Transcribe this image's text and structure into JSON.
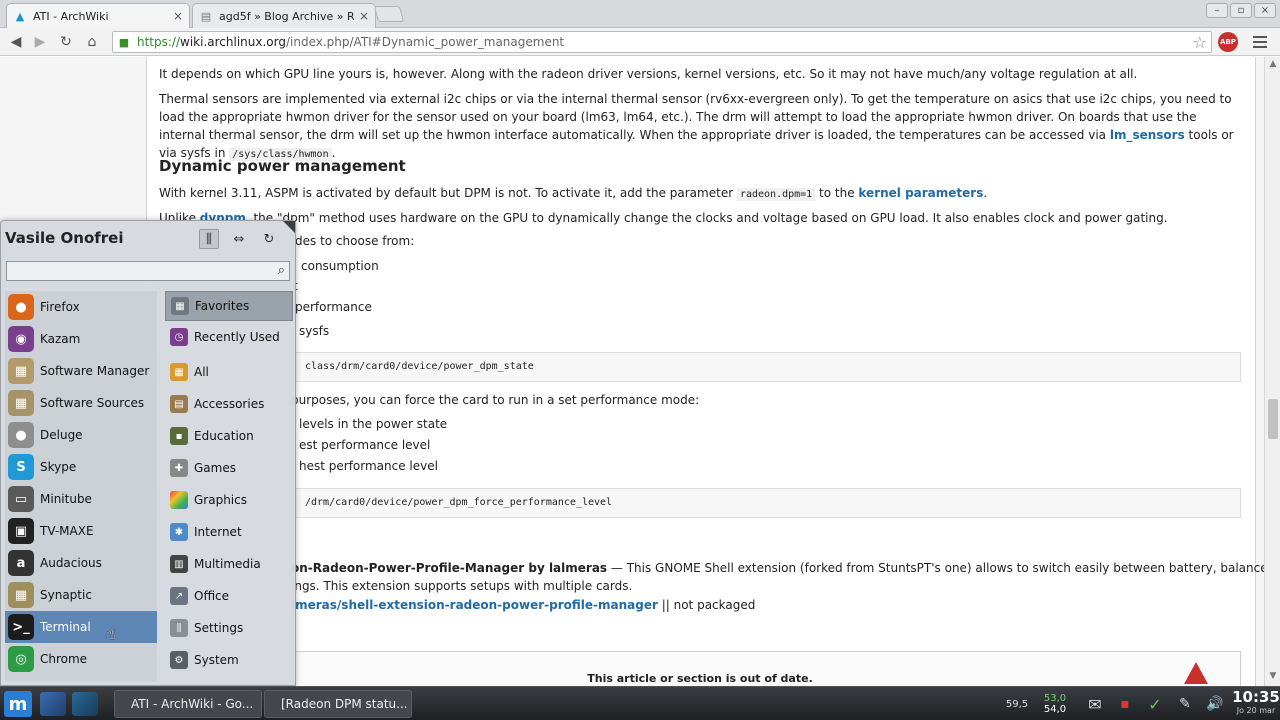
{
  "browser": {
    "tabs": [
      {
        "title": "ATI - ArchWiki",
        "close": "×"
      },
      {
        "title": "agd5f » Blog Archive » Ra",
        "close": "×"
      }
    ],
    "window_controls": {
      "minimize": "–",
      "maximize": "▫",
      "close": "×"
    },
    "url": {
      "scheme": "https://",
      "host": "wiki.archlinux.org",
      "path": "/index.php/ATI#Dynamic_power_management"
    },
    "abp_label": "ABP"
  },
  "article": {
    "p1": "It depends on which GPU line yours is, however. Along with the radeon driver versions, kernel versions, etc. So it may not have much/any voltage regulation at all.",
    "p2_a": "Thermal sensors are implemented via external i2c chips or via the internal thermal sensor (rv6xx-evergreen only). To get the temperature on asics that use i2c chips, you need to load the appropriate hwmon driver for the sensor used on your board (lm63, lm64, etc.). The drm will attempt to load the appropriate hwmon driver. On boards that use the internal thermal sensor, the drm will set up the hwmon interface automatically. When the appropriate driver is loaded, the temperatures can be accessed via ",
    "p2_link": "lm_sensors",
    "p2_b": " tools or via sysfs in ",
    "p2_code": "/sys/class/hwmon",
    "p2_c": ".",
    "heading": "Dynamic power management",
    "p3_a": "With kernel 3.11, ASPM is activated by default but DPM is not. To activate it, add the parameter ",
    "p3_code": "radeon.dpm=1",
    "p3_b": " to the ",
    "p3_link": "kernel parameters",
    "p3_c": ".",
    "p4_a": "Unlike ",
    "p4_link": "dynpm",
    "p4_b": ", the \"dpm\" method uses hardware on the GPU to dynamically change the clocks and voltage based on GPU load. It also enables clock and power gating.",
    "p5": "des to choose from:",
    "l1": "consumption",
    "l2": "t",
    "l3": "performance",
    "l4": "sysfs",
    "pre1": "class/drm/card0/device/power_dpm_state",
    "p6": "purposes, you can force the card to run in a set performance mode:",
    "l5": "levels in the power state",
    "l6": "est performance level",
    "l7": "hest performance level",
    "pre2": "/drm/card0/device/power_dpm_force_performance_level",
    "ext_title": "on-Radeon-Power-Profile-Manager by lalmeras",
    "ext_desc_a": " — This GNOME Shell extension (forked from StuntsPT's one) allows to switch easily between battery, balanced and",
    "ext_desc_b": "ings. This extension supports setups with multiple cards.",
    "ext_link": "lmeras/shell-extension-radeon-power-profile-manager",
    "ext_suffix": " || not packaged",
    "notice": "This article or section is out of date."
  },
  "startmenu": {
    "user": "Vasile Onofrei",
    "apps": [
      {
        "label": "Firefox",
        "color": "#d9661b"
      },
      {
        "label": "Kazam",
        "color": "#7a3f8c"
      },
      {
        "label": "Software Manager",
        "color": "#b49a6a"
      },
      {
        "label": "Software Sources",
        "color": "#a89268"
      },
      {
        "label": "Deluge",
        "color": "#8e8e8e"
      },
      {
        "label": "Skype",
        "color": "#1f9ad6"
      },
      {
        "label": "Minitube",
        "color": "#5a5a5a"
      },
      {
        "label": "TV-MAXE",
        "color": "#222222"
      },
      {
        "label": "Audacious",
        "color": "#333333"
      },
      {
        "label": "Synaptic",
        "color": "#9f8e5e"
      },
      {
        "label": "Terminal",
        "color": "#1c1c1c"
      },
      {
        "label": "Chrome",
        "color": "#2d9a46"
      }
    ],
    "categories": [
      {
        "label": "Favorites",
        "color": "#6f7780"
      },
      {
        "label": "Recently Used",
        "color": "#7a3f8c"
      },
      {
        "label": "All",
        "color": "#d99a2e"
      },
      {
        "label": "Accessories",
        "color": "#9b7a4e"
      },
      {
        "label": "Education",
        "color": "#5a6a3a"
      },
      {
        "label": "Games",
        "color": "#888888"
      },
      {
        "label": "Graphics",
        "color": "#c0498c"
      },
      {
        "label": "Internet",
        "color": "#4f8bc9"
      },
      {
        "label": "Multimedia",
        "color": "#444444"
      },
      {
        "label": "Office",
        "color": "#6a7480"
      },
      {
        "label": "Settings",
        "color": "#8a8f94"
      },
      {
        "label": "System",
        "color": "#5a5f64"
      }
    ]
  },
  "taskbar": {
    "menu_glyph": "m",
    "tasks": [
      {
        "label": "ATI - ArchWiki - Go..."
      },
      {
        "label": "[Radeon DPM statu..."
      }
    ],
    "tray": {
      "cpu": "59,5",
      "temp_top": "53,0",
      "temp_bottom": "54,0"
    },
    "clock": {
      "time": "10:35",
      "date": "Jo 20 mar"
    }
  }
}
